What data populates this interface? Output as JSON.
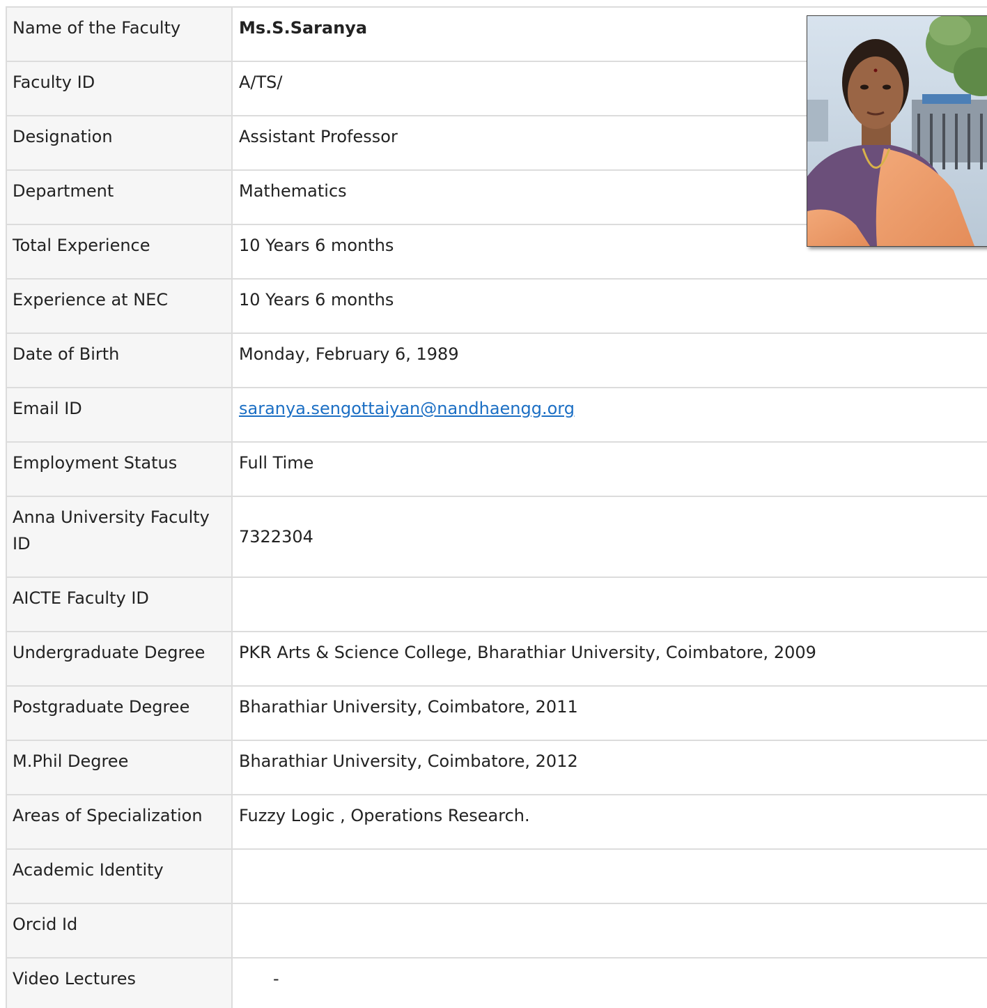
{
  "rows": [
    {
      "label": "Name of the Faculty",
      "value": "Ms.S.Saranya"
    },
    {
      "label": "Faculty ID",
      "value": "A/TS/"
    },
    {
      "label": "Designation",
      "value": "Assistant Professor"
    },
    {
      "label": "Department",
      "value": "Mathematics"
    },
    {
      "label": "Total Experience",
      "value": "10 Years 6 months"
    },
    {
      "label": "Experience at NEC",
      "value": "10 Years 6 months"
    },
    {
      "label": "Date of Birth",
      "value": "Monday, February 6, 1989"
    },
    {
      "label": "Email ID",
      "value": "saranya.sengottaiyan@nandhaengg.org"
    },
    {
      "label": "Employment Status",
      "value": "Full Time"
    },
    {
      "label": "Anna University Faculty ID",
      "value": "7322304"
    },
    {
      "label": "AICTE Faculty ID",
      "value": ""
    },
    {
      "label": "Undergraduate Degree",
      "value": "PKR Arts & Science College, Bharathiar University, Coimbatore, 2009"
    },
    {
      "label": "Postgraduate Degree",
      "value": "Bharathiar University, Coimbatore, 2011"
    },
    {
      "label": "M.Phil Degree",
      "value": "Bharathiar University, Coimbatore, 2012"
    },
    {
      "label": "Areas of Specialization",
      "value": "Fuzzy Logic , Operations Research."
    },
    {
      "label": "Academic Identity",
      "value": ""
    },
    {
      "label": "Orcid Id",
      "value": ""
    },
    {
      "label": "Video Lectures",
      "value": "-"
    }
  ],
  "colors": {
    "link": "#1c6fc4",
    "border": "#dcdcdc",
    "label_bg": "#f6f6f6"
  }
}
